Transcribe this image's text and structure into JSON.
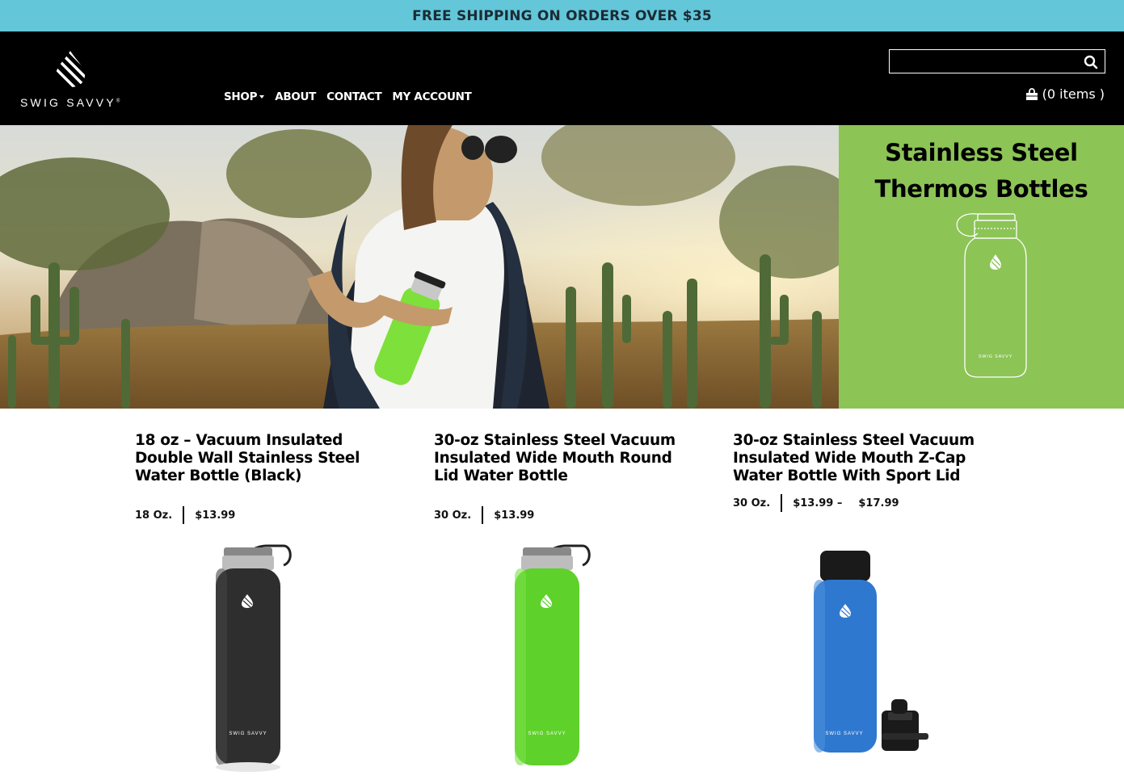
{
  "promo": {
    "text": "FREE SHIPPING ON ORDERS OVER $35"
  },
  "brand": {
    "name": "SWIG SAVVY",
    "mark": "®"
  },
  "nav": [
    {
      "label": "SHOP",
      "dropdown": true
    },
    {
      "label": "ABOUT"
    },
    {
      "label": "CONTACT"
    },
    {
      "label": "MY ACCOUNT"
    }
  ],
  "search": {
    "placeholder": "",
    "value": ""
  },
  "cart": {
    "label": "(0 items )"
  },
  "hero": {
    "title_line1": "Stainless Steel",
    "title_line2": "Thermos Bottles",
    "bottle_brand": "SWIG SAVVY",
    "panel_color": "#8cc456"
  },
  "products": [
    {
      "title": "18 oz – Vacuum Insulated Double Wall Stainless Steel Water Bottle (Black)",
      "size": "18 Oz.",
      "price": "$13.99",
      "color": "#2e2e2e",
      "image_brand": "SWIG SAVVY"
    },
    {
      "title": "30-oz Stainless Steel Vacuum Insulated Wide Mouth Round Lid Water Bottle",
      "size": "30 Oz.",
      "price": "$13.99",
      "color": "#5ed12a",
      "image_brand": "SWIG SAVVY"
    },
    {
      "title": "30-oz Stainless Steel Vacuum Insulated Wide Mouth Z-Cap Water Bottle With Sport Lid",
      "size": "30 Oz.",
      "price": "$13.99 –",
      "price_max": "$17.99",
      "color": "#2f78cf",
      "image_brand": "SWIG SAVVY"
    }
  ],
  "colors": {
    "promo_bg": "#63c6d9",
    "header_bg": "#000000",
    "accent_green": "#8cc456"
  },
  "icons": [
    "swig-savvy-logo-icon",
    "search-icon",
    "shopping-bag-icon",
    "caret-down-icon"
  ]
}
